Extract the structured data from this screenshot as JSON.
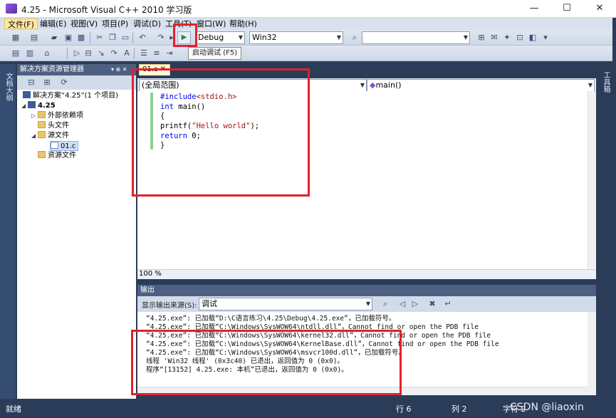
{
  "window": {
    "title": "4.25 - Microsoft Visual C++ 2010 学习版",
    "minimize_glyph": "—",
    "maximize_glyph": "☐",
    "close_glyph": "✕"
  },
  "menu": [
    "文件(F)",
    "编辑(E)",
    "视图(V)",
    "项目(P)",
    "调试(D)",
    "工具(T)",
    "窗口(W)",
    "帮助(H)"
  ],
  "toolbar": {
    "config": "Debug",
    "platform": "Win32",
    "search_value": "",
    "start_debug_tooltip": "启动调试 (F5)"
  },
  "left_strip_label": "文档大纲",
  "right_strip_label": "工具箱",
  "solution_explorer": {
    "title": "解决方案资源管理器",
    "pin_glyph": "▾ ⊕ ✕",
    "tree": {
      "solution": "解决方案“4.25”(1 个项目)",
      "project": "4.25",
      "external": "外部依赖项",
      "headers": "头文件",
      "sources": "源文件",
      "source_file": "01.c",
      "resources": "资源文件"
    }
  },
  "editor": {
    "tab": "01.c",
    "scope": "(全局范围)",
    "member": "main()",
    "zoom": "100 %",
    "code": {
      "l1_kw": "#include",
      "l1_str": "<stdio.h>",
      "l2_kw": "int",
      "l2_rest": " main()",
      "l3": "{",
      "l4_pre": "printf(",
      "l4_str": "\"Hello world\"",
      "l4_post": ");",
      "l5_kw": "return",
      "l5_rest": " 0;",
      "l6": "}"
    }
  },
  "output": {
    "title": "输出",
    "source_label": "显示输出来源(S):",
    "source_value": "调试",
    "lines": [
      "“4.25.exe”: 已加载“D:\\C语言练习\\4.25\\Debug\\4.25.exe”，已加载符号。",
      "“4.25.exe”: 已加载“C:\\Windows\\SysWOW64\\ntdll.dll”，Cannot find or open the PDB file",
      "“4.25.exe”: 已加载“C:\\Windows\\SysWOW64\\kernel32.dll”，Cannot find or open the PDB file",
      "“4.25.exe”: 已加载“C:\\Windows\\SysWOW64\\KernelBase.dll”，Cannot find or open the PDB file",
      "“4.25.exe”: 已加载“C:\\Windows\\SysWOW64\\msvcr100d.dll”，已加载符号。",
      "线程 'Win32 线程' (0x3c40) 已退出，返回值为 0 (0x0)。",
      "程序“[13152] 4.25.exe: 本机”已退出，返回值为 0 (0x0)。"
    ]
  },
  "status": {
    "ready": "就绪",
    "line": "行 6",
    "col": "列 2",
    "char": "字符 2",
    "watermark": "CSDN @liaoxin"
  }
}
